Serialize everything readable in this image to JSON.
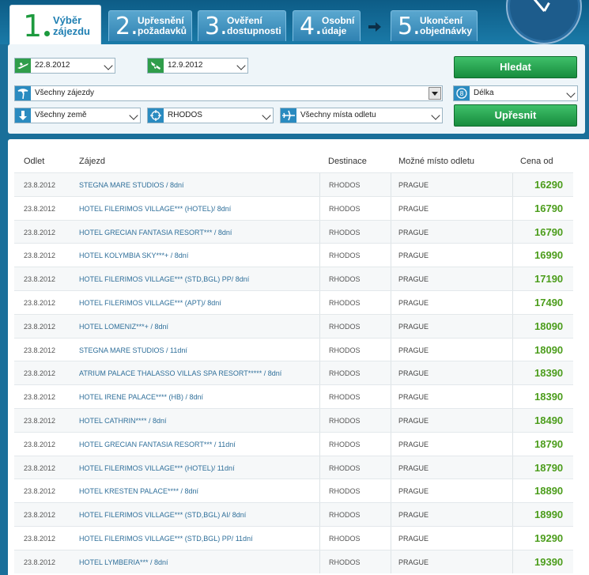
{
  "steps": [
    {
      "num": "1",
      "label1": "Výběr",
      "label2": "zájezdu"
    },
    {
      "num": "2.",
      "label1": "Upřesnění",
      "label2": "požadavků"
    },
    {
      "num": "3.",
      "label1": "Ověření",
      "label2": "dostupnosti"
    },
    {
      "num": "4.",
      "label1": "Osobní",
      "label2": "údaje"
    },
    {
      "num": "5.",
      "label1": "Ukončení",
      "label2": "objednávky"
    }
  ],
  "search": {
    "date_from": "22.8.2012",
    "date_to": "12.9.2012",
    "trip_type": "Všechny zájezdy",
    "country": "Všechny země",
    "destination": "RHODOS",
    "departure": "Všechny místa odletu",
    "length": "Délka",
    "search_button": "Hledat",
    "refine_button": "Upřesnit"
  },
  "table": {
    "headers": {
      "date": "Odlet",
      "hotel": "Zájezd",
      "destination": "Destinace",
      "departure": "Možné místo odletu",
      "price": "Cena od"
    },
    "rows": [
      {
        "date": "23.8.2012",
        "hotel": "STEGNA MARE STUDIOS / 8dní",
        "dest": "RHODOS",
        "dep": "PRAGUE",
        "price": "16290"
      },
      {
        "date": "23.8.2012",
        "hotel": "HOTEL FILERIMOS VILLAGE*** (HOTEL)/ 8dní",
        "dest": "RHODOS",
        "dep": "PRAGUE",
        "price": "16790"
      },
      {
        "date": "23.8.2012",
        "hotel": "HOTEL GRECIAN FANTASIA RESORT*** / 8dní",
        "dest": "RHODOS",
        "dep": "PRAGUE",
        "price": "16790"
      },
      {
        "date": "23.8.2012",
        "hotel": "HOTEL KOLYMBIA SKY***+ / 8dní",
        "dest": "RHODOS",
        "dep": "PRAGUE",
        "price": "16990"
      },
      {
        "date": "23.8.2012",
        "hotel": "HOTEL FILERIMOS VILLAGE*** (STD,BGL) PP/ 8dní",
        "dest": "RHODOS",
        "dep": "PRAGUE",
        "price": "17190"
      },
      {
        "date": "23.8.2012",
        "hotel": "HOTEL FILERIMOS VILLAGE*** (APT)/ 8dní",
        "dest": "RHODOS",
        "dep": "PRAGUE",
        "price": "17490"
      },
      {
        "date": "23.8.2012",
        "hotel": "HOTEL LOMENIZ***+ / 8dní",
        "dest": "RHODOS",
        "dep": "PRAGUE",
        "price": "18090"
      },
      {
        "date": "23.8.2012",
        "hotel": "STEGNA MARE STUDIOS / 11dní",
        "dest": "RHODOS",
        "dep": "PRAGUE",
        "price": "18090"
      },
      {
        "date": "23.8.2012",
        "hotel": "ATRIUM PALACE THALASSO VILLAS SPA RESORT***** / 8dní",
        "dest": "RHODOS",
        "dep": "PRAGUE",
        "price": "18390"
      },
      {
        "date": "23.8.2012",
        "hotel": "HOTEL IRENE PALACE**** (HB) / 8dní",
        "dest": "RHODOS",
        "dep": "PRAGUE",
        "price": "18390"
      },
      {
        "date": "23.8.2012",
        "hotel": "HOTEL CATHRIN**** / 8dní",
        "dest": "RHODOS",
        "dep": "PRAGUE",
        "price": "18490"
      },
      {
        "date": "23.8.2012",
        "hotel": "HOTEL GRECIAN FANTASIA RESORT*** / 11dní",
        "dest": "RHODOS",
        "dep": "PRAGUE",
        "price": "18790"
      },
      {
        "date": "23.8.2012",
        "hotel": "HOTEL FILERIMOS VILLAGE*** (HOTEL)/ 11dní",
        "dest": "RHODOS",
        "dep": "PRAGUE",
        "price": "18790"
      },
      {
        "date": "23.8.2012",
        "hotel": "HOTEL KRESTEN PALACE**** / 8dní",
        "dest": "RHODOS",
        "dep": "PRAGUE",
        "price": "18890"
      },
      {
        "date": "23.8.2012",
        "hotel": "HOTEL FILERIMOS VILLAGE*** (STD,BGL) AI/ 8dní",
        "dest": "RHODOS",
        "dep": "PRAGUE",
        "price": "18990"
      },
      {
        "date": "23.8.2012",
        "hotel": "HOTEL FILERIMOS VILLAGE*** (STD,BGL) PP/ 11dní",
        "dest": "RHODOS",
        "dep": "PRAGUE",
        "price": "19290"
      },
      {
        "date": "23.8.2012",
        "hotel": "HOTEL LYMBERIA*** / 8dní",
        "dest": "RHODOS",
        "dep": "PRAGUE",
        "price": "19390"
      }
    ]
  }
}
